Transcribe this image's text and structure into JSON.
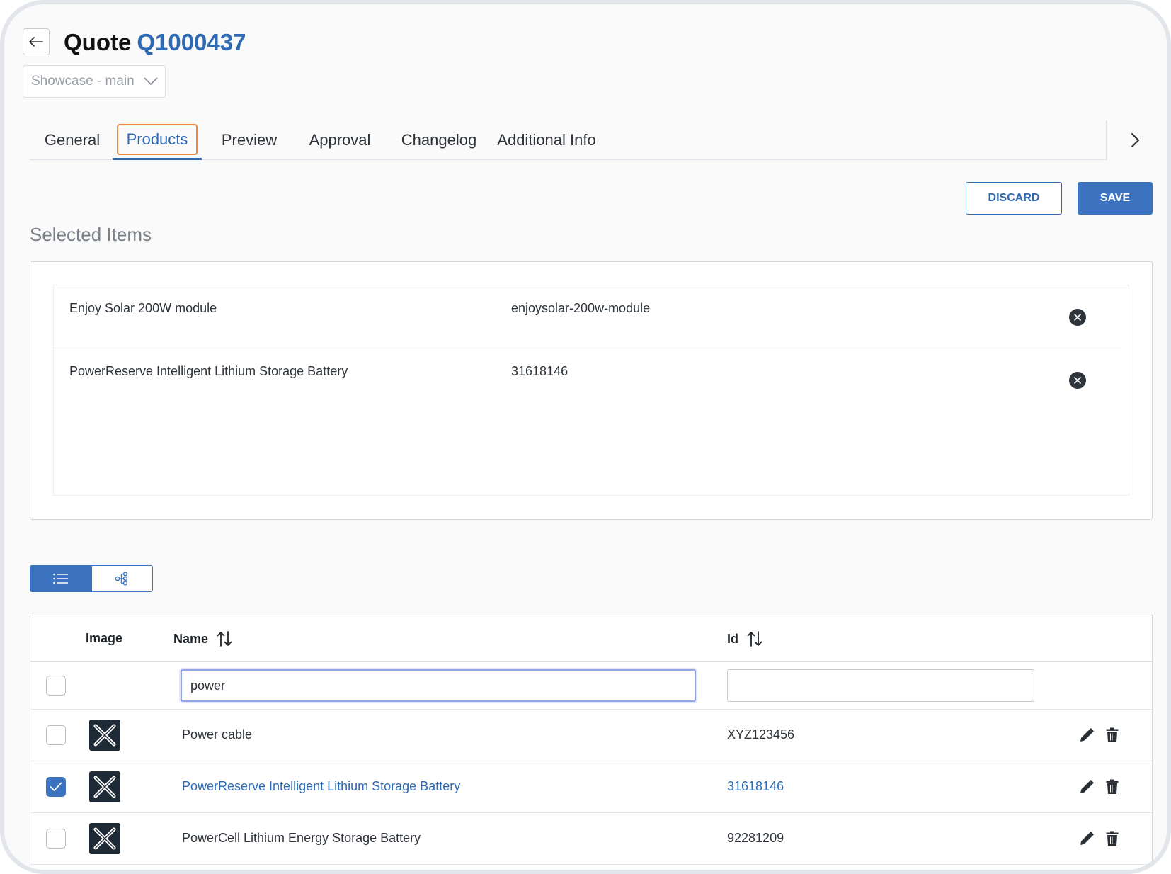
{
  "header": {
    "title_prefix": "Quote",
    "quote_id": "Q1000437"
  },
  "branch_select": {
    "value": "Showcase - main"
  },
  "tabs": [
    {
      "label": "General"
    },
    {
      "label": "Products",
      "active": true
    },
    {
      "label": "Preview"
    },
    {
      "label": "Approval"
    },
    {
      "label": "Changelog"
    },
    {
      "label": "Additional Info"
    }
  ],
  "actions": {
    "discard_label": "DISCARD",
    "save_label": "SAVE"
  },
  "selected_items": {
    "title": "Selected Items",
    "items": [
      {
        "name": "Enjoy Solar 200W module",
        "id": "enjoysolar-200w-module"
      },
      {
        "name": "PowerReserve Intelligent Lithium Storage Battery",
        "id": "31618146"
      }
    ]
  },
  "table": {
    "columns": {
      "image": "Image",
      "name": "Name",
      "id": "Id"
    },
    "filters": {
      "name_value": "power",
      "id_value": ""
    },
    "rows": [
      {
        "name": "Power cable",
        "id": "XYZ123456",
        "checked": false
      },
      {
        "name": "PowerReserve Intelligent Lithium Storage Battery",
        "id": "31618146",
        "checked": true
      },
      {
        "name": "PowerCell Lithium Energy Storage Battery",
        "id": "92281209",
        "checked": false
      }
    ]
  },
  "colors": {
    "accent": "#3b73c0",
    "link": "#2e6ab4",
    "tab_focus": "#ea8a45",
    "icon_dark": "#1f2a37"
  },
  "icons": {
    "back": "arrow-left-icon",
    "dropdown": "chevron-down-icon",
    "tabs_next": "chevron-right-icon",
    "remove": "close-circle-icon",
    "list_view": "list-icon",
    "tree_view": "hierarchy-icon",
    "sort": "sort-icon",
    "edit": "pencil-icon",
    "delete": "trash-icon",
    "thumbnail": "placeholder-x-icon"
  }
}
